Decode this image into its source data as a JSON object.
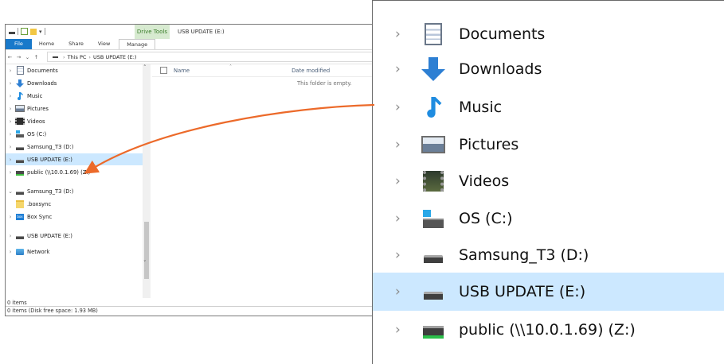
{
  "window": {
    "title": "USB UPDATE (E:)",
    "context_tab": "Drive Tools",
    "ribbon_tabs": [
      "File",
      "Home",
      "Share",
      "View",
      "Manage"
    ],
    "breadcrumb": [
      "This PC",
      "USB UPDATE (E:)"
    ],
    "nav_glyphs": {
      "back": "←",
      "forward": "→",
      "recent": "⌄",
      "up": "↑",
      "chevron": "›",
      "expand": "›",
      "collapse": "⌄",
      "scroll_up": "˄",
      "scroll_down": "˅",
      "sort": "˄",
      "qa_dropdown": "▾"
    }
  },
  "nav_pane": {
    "items": [
      {
        "label": "Documents",
        "icon": "documents-icon"
      },
      {
        "label": "Downloads",
        "icon": "downloads-icon"
      },
      {
        "label": "Music",
        "icon": "music-icon"
      },
      {
        "label": "Pictures",
        "icon": "pictures-icon"
      },
      {
        "label": "Videos",
        "icon": "videos-icon"
      },
      {
        "label": "OS (C:)",
        "icon": "os-drive-icon"
      },
      {
        "label": "Samsung_T3 (D:)",
        "icon": "drive-icon"
      },
      {
        "label": "USB UPDATE (E:)",
        "icon": "drive-icon",
        "selected": true
      },
      {
        "label": "public (\\\\10.0.1.69) (Z:)",
        "icon": "network-drive-icon"
      },
      {
        "label": "Samsung_T3 (D:)",
        "icon": "drive-icon",
        "expanded": true
      },
      {
        "label": ".boxsync",
        "icon": "folder-icon",
        "child": true
      },
      {
        "label": "Box Sync",
        "icon": "box-sync-icon",
        "child": true
      },
      {
        "label": "USB UPDATE (E:)",
        "icon": "drive-icon"
      },
      {
        "label": "Network",
        "icon": "network-icon"
      }
    ],
    "box_icon_text": "box"
  },
  "content": {
    "columns": [
      "Name",
      "Date modified"
    ],
    "empty_message": "This folder is empty."
  },
  "status": {
    "items": "0 items",
    "detail": "0 items (Disk free space: 1.93 MB)"
  },
  "zoom": {
    "items": [
      {
        "label": "Documents",
        "icon": "documents-icon"
      },
      {
        "label": "Downloads",
        "icon": "downloads-icon"
      },
      {
        "label": "Music",
        "icon": "music-icon"
      },
      {
        "label": "Pictures",
        "icon": "pictures-icon"
      },
      {
        "label": "Videos",
        "icon": "videos-icon"
      },
      {
        "label": "OS (C:)",
        "icon": "os-drive-icon"
      },
      {
        "label": "Samsung_T3 (D:)",
        "icon": "drive-icon"
      },
      {
        "label": "USB UPDATE (E:)",
        "icon": "drive-icon",
        "selected": true
      },
      {
        "label": "public (\\\\10.0.1.69) (Z:)",
        "icon": "network-drive-icon"
      }
    ]
  },
  "colors": {
    "selection": "#cce8ff",
    "file_tab": "#1979ca",
    "callout_arrow": "#ec6a2a",
    "downloads_blue": "#2d7fd3",
    "music_blue": "#1f8ce0"
  }
}
